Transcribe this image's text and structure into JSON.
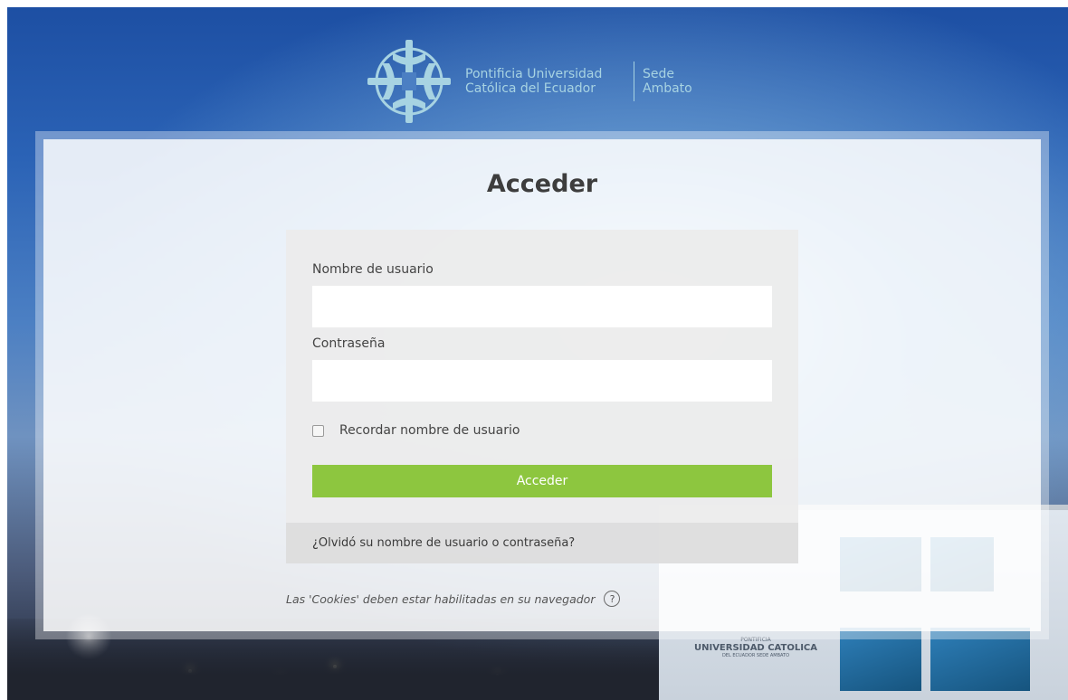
{
  "branding": {
    "university_line1": "Pontificia Universidad",
    "university_line2": "Católica del Ecuador",
    "campus_line1": "Sede",
    "campus_line2": "Ambato",
    "logo_icon": "puce-cross-logo",
    "brand_color": "#a7d3e2"
  },
  "login": {
    "title": "Acceder",
    "username_label": "Nombre de usuario",
    "username_value": "",
    "password_label": "Contraseña",
    "password_value": "",
    "remember_label": "Recordar nombre de usuario",
    "remember_checked": false,
    "submit_label": "Acceder",
    "submit_color": "#8dc63f",
    "forgot_link": "¿Olvidó su nombre de usuario o contraseña?",
    "cookies_notice": "Las 'Cookies' deben estar habilitadas en su navegador",
    "help_icon": "question-circle-icon"
  },
  "background": {
    "building_sign_line1": "PONTIFICIA",
    "building_sign_line2": "UNIVERSIDAD CATOLICA",
    "building_sign_line3": "DEL ECUADOR SEDE AMBATO"
  }
}
